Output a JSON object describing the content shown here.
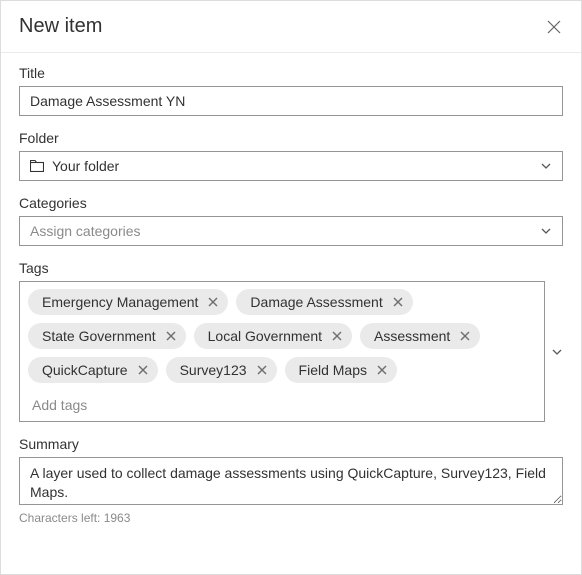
{
  "dialog": {
    "title": "New item"
  },
  "fields": {
    "title": {
      "label": "Title",
      "value": "Damage Assessment YN"
    },
    "folder": {
      "label": "Folder",
      "value": "Your folder"
    },
    "categories": {
      "label": "Categories",
      "placeholder": "Assign categories"
    },
    "tags": {
      "label": "Tags",
      "placeholder": "Add tags",
      "items": [
        "Emergency Management",
        "Damage Assessment",
        "State Government",
        "Local Government",
        "Assessment",
        "QuickCapture",
        "Survey123",
        "Field Maps"
      ]
    },
    "summary": {
      "label": "Summary",
      "value": "A layer used to collect damage assessments using QuickCapture, Survey123, Field Maps.",
      "charCountText": "Characters left: 1963"
    }
  }
}
